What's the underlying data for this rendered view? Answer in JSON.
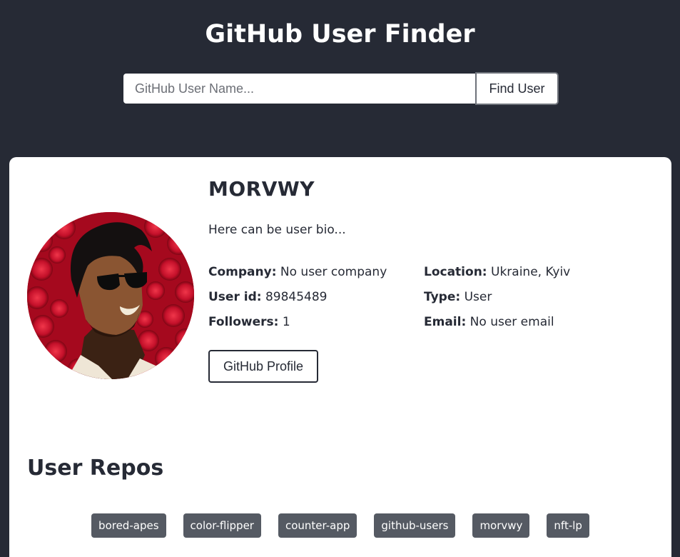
{
  "header": {
    "title": "GitHub User Finder",
    "search_placeholder": "GitHub User Name...",
    "find_button_label": "Find User"
  },
  "profile": {
    "username": "MORVWY",
    "bio": "Here can be user bio...",
    "details": {
      "company_label": "Company:",
      "company_value": "No user company",
      "location_label": "Location:",
      "location_value": "Ukraine, Kyiv",
      "user_id_label": "User id:",
      "user_id_value": "89845489",
      "type_label": "Type:",
      "type_value": "User",
      "followers_label": "Followers:",
      "followers_value": "1",
      "email_label": "Email:",
      "email_value": "No user email"
    },
    "profile_button_label": "GitHub Profile"
  },
  "repos": {
    "title": "User Repos",
    "items": [
      "bored-apes",
      "color-flipper",
      "counter-app",
      "github-users",
      "morvwy",
      "nft-lp"
    ]
  },
  "colors": {
    "background": "#262a35",
    "card": "#ffffff",
    "repo_tag": "#555a63",
    "avatar_accent": "#b3061b"
  }
}
